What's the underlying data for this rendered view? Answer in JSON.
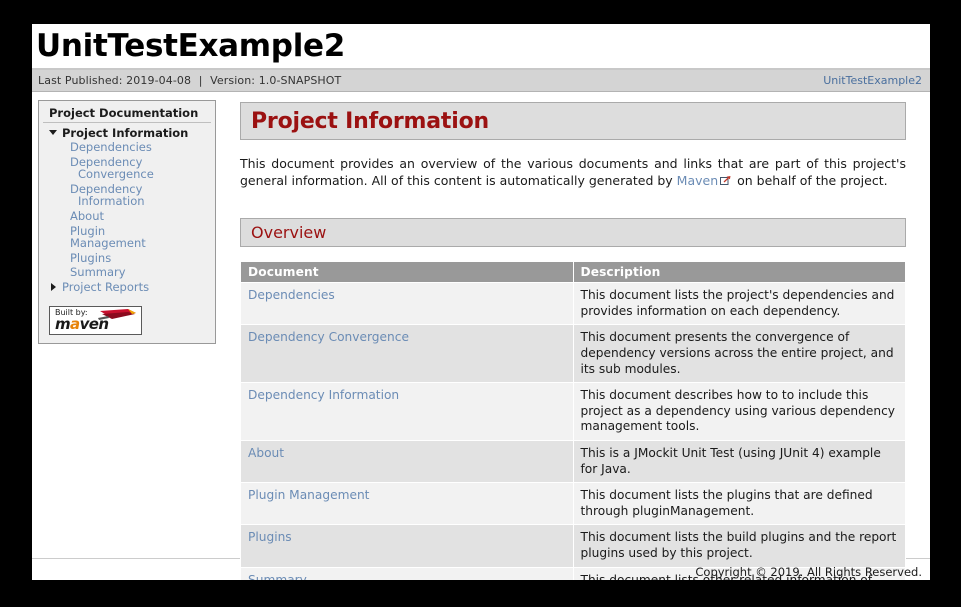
{
  "banner": {
    "title": "UnitTestExample2"
  },
  "infobar": {
    "last_published_label": "Last Published: 2019-04-08",
    "separator": "|",
    "version_label": "Version: 1.0-SNAPSHOT",
    "breadcrumb_link": "UnitTestExample2"
  },
  "sidebar": {
    "section_title": "Project Documentation",
    "groups": [
      {
        "label": "Project Information",
        "expanded": true,
        "marker": "triangle-down-icon",
        "children": [
          {
            "label": "Dependencies",
            "line2": ""
          },
          {
            "label": "Dependency",
            "line2": "Convergence"
          },
          {
            "label": "Dependency",
            "line2": "Information"
          },
          {
            "label": "About",
            "line2": ""
          },
          {
            "label": "Plugin Management",
            "line2": ""
          },
          {
            "label": "Plugins",
            "line2": ""
          },
          {
            "label": "Summary",
            "line2": ""
          }
        ]
      },
      {
        "label": "Project Reports",
        "expanded": false,
        "marker": "triangle-right-icon",
        "children": []
      }
    ],
    "badge": {
      "built_by": "Built by:",
      "name_part1": "m",
      "name_part2": "a",
      "name_part3": "ven",
      "accent_color": "#e8840a"
    }
  },
  "main": {
    "page_title": "Project Information",
    "intro_before_link": "This document provides an overview of the various documents and links that are part of this project's general information. All of this content is automatically generated by ",
    "intro_link": "Maven",
    "intro_after_link": " on behalf of the project.",
    "overview_title": "Overview",
    "table": {
      "columns": [
        "Document",
        "Description"
      ],
      "rows": [
        {
          "document": "Dependencies",
          "document_line2": "",
          "description": "This document lists the project's dependencies and provides information on each dependency."
        },
        {
          "document": "Dependency",
          "document_line2": "Convergence",
          "description": "This document presents the convergence of dependency versions across the entire project, and its sub modules."
        },
        {
          "document": "Dependency",
          "document_line2": "Information",
          "description": "This document describes how to to include this project as a dependency using various dependency management tools."
        },
        {
          "document": "About",
          "document_line2": "",
          "description": "This is a JMockit Unit Test (using JUnit 4) example for Java."
        },
        {
          "document": "Plugin Management",
          "document_line2": "",
          "description": "This document lists the plugins that are defined through pluginManagement."
        },
        {
          "document": "Plugins",
          "document_line2": "",
          "description": "This document lists the build plugins and the report plugins used by this project."
        },
        {
          "document": "Summary",
          "document_line2": "",
          "description": "This document lists other related information of this project"
        }
      ]
    }
  },
  "footer": {
    "copyright": "Copyright © 2019. All Rights Reserved."
  },
  "colors": {
    "heading_red": "#9b1111",
    "link_blue": "#6b8cb5",
    "breadcrumb_blue": "#4a6f9e",
    "table_header_gray": "#999999",
    "section_head_gray": "#dddddd"
  }
}
